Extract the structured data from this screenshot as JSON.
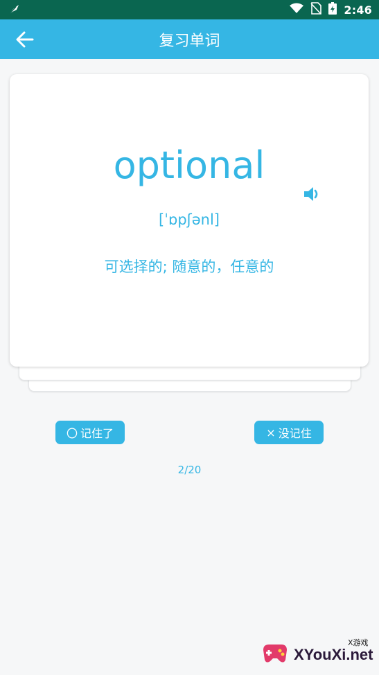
{
  "status_bar": {
    "time": "2:46",
    "left_icon": "feather-icon",
    "right_icons": [
      "wifi-icon",
      "no-sim-icon",
      "battery-icon"
    ]
  },
  "app_bar": {
    "title": "复习单词",
    "back_icon": "arrow-left-icon"
  },
  "card": {
    "word": "optional",
    "phonetic": "[ˈɒpʃənl]",
    "meaning": "可选择的; 随意的，任意的",
    "speaker_icon": "speaker-icon"
  },
  "actions": {
    "remember_icon": "〇",
    "remember_label": "记住了",
    "forgot_icon": "×",
    "forgot_label": "没记住"
  },
  "progress": "2/20",
  "watermark": {
    "brand": "XYouXi.net",
    "tagline": "X游戏"
  },
  "colors": {
    "accent": "#35b6e4",
    "status_bar": "#0a6650",
    "background": "#f6f7f8"
  }
}
